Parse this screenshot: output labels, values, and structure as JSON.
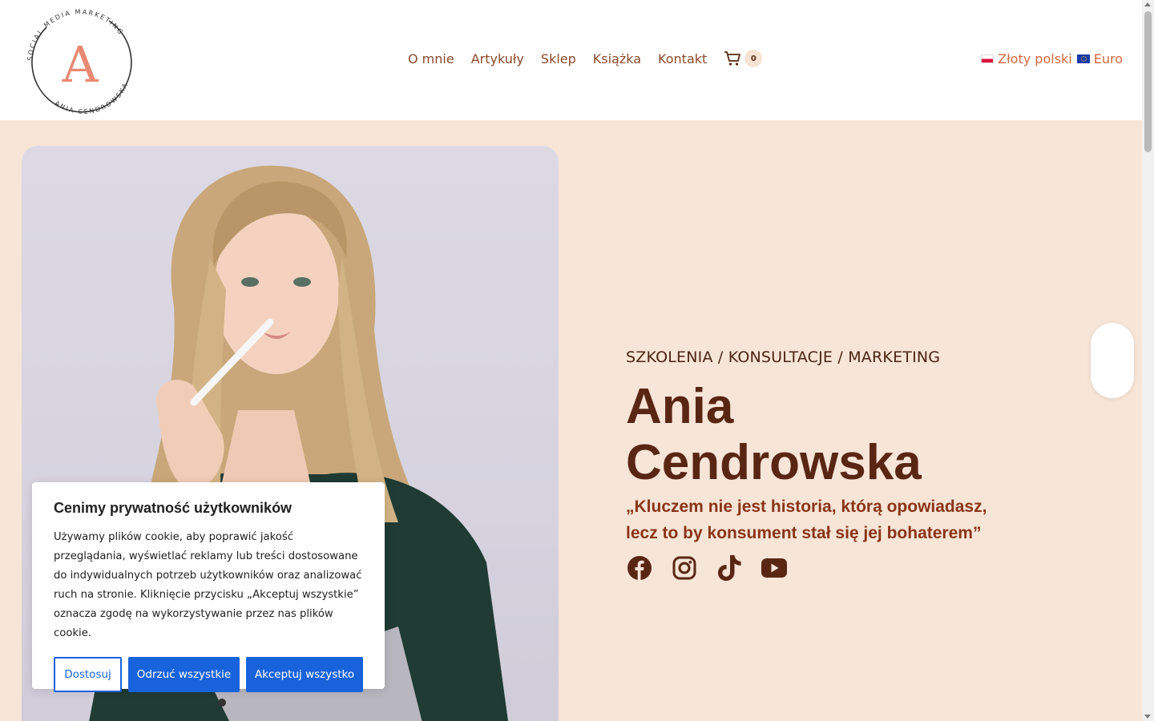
{
  "logo": {
    "ring_top_text": "SOCIAL MEDIA MARKETING",
    "ring_bottom_text": "ANIA CENDROWSKA",
    "letter": "A"
  },
  "nav": {
    "items": [
      {
        "label": "O mnie"
      },
      {
        "label": "Artykuły"
      },
      {
        "label": "Sklep"
      },
      {
        "label": "Książka"
      },
      {
        "label": "Kontakt"
      }
    ],
    "cart_icon": "cart-icon",
    "cart_count": "0"
  },
  "currency": {
    "options": [
      {
        "flag": "pl-flag-icon",
        "label": "Złoty polski"
      },
      {
        "flag": "eu-flag-icon",
        "label": "Euro"
      }
    ]
  },
  "hero": {
    "subtitle": "SZKOLENIA / KONSULTACJE / MARKETING",
    "name_line1": "Ania",
    "name_line2": "Cendrowska",
    "quote_line1": "„Kluczem nie jest historia, którą opowiadasz,",
    "quote_line2": "lecz to by konsument stał się jej bohaterem”",
    "socials": [
      "facebook-icon",
      "instagram-icon",
      "tiktok-icon",
      "youtube-icon"
    ]
  },
  "cookie": {
    "title": "Cenimy prywatność użytkowników",
    "body": "Używamy plików cookie, aby poprawić jakość przeglądania, wyświetlać reklamy lub treści dostosowane do indywidualnych potrzeb użytkowników oraz analizować ruch na stronie. Kliknięcie przycisku „Akceptuj wszystkie” oznacza zgodę na wykorzystywanie przez nas plików cookie.",
    "customize_label": "Dostosuj",
    "reject_label": "Odrzuć wszystkie",
    "accept_label": "Akceptuj wszystko"
  },
  "colors": {
    "nav_text": "#8a4a2a",
    "accent": "#d3693f",
    "hero_bg": "#f7e5d7",
    "name": "#5a2614",
    "quote": "#8a3418",
    "cookie_button": "#1863dc"
  }
}
